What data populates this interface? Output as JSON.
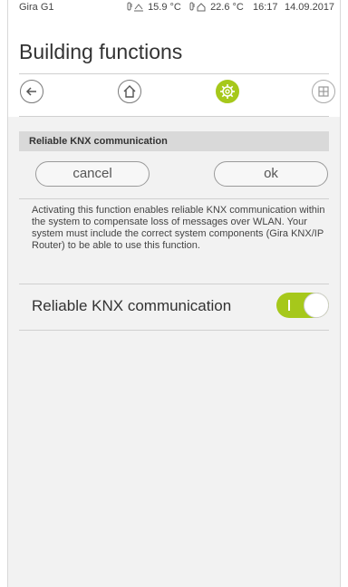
{
  "status": {
    "device": "Gira G1",
    "temp_outdoor": "15.9 °C",
    "temp_indoor": "22.6 °C",
    "time": "16:17",
    "date": "14.09.2017"
  },
  "page": {
    "title": "Building functions"
  },
  "nav": {
    "items": [
      {
        "icon": "back-arrow-icon"
      },
      {
        "icon": "home-icon"
      },
      {
        "icon": "settings-gear-icon",
        "active": true
      },
      {
        "icon": "grid-icon"
      }
    ],
    "accent_color": "#a6c81b"
  },
  "section": {
    "header": "Reliable KNX communication"
  },
  "buttons": {
    "cancel": "cancel",
    "ok": "ok"
  },
  "description": "Activating this function enables reliable KNX communication within the system to compensate loss of messages over WLAN. Your system must include the correct system components (Gira KNX/IP Router) to be able to use this function.",
  "setting": {
    "label": "Reliable KNX communication",
    "enabled": true
  }
}
